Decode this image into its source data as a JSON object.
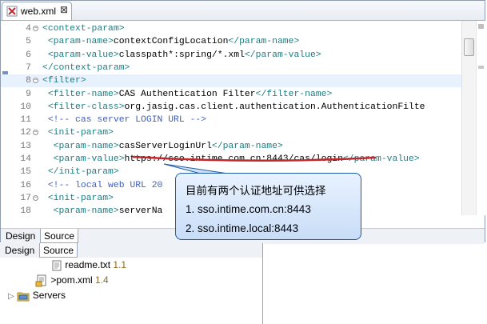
{
  "editor": {
    "tab_label": "web.xml",
    "tab_close": "⊠",
    "lines": [
      {
        "n": "4",
        "fold": true,
        "parts": [
          [
            "t",
            "<context-param>"
          ]
        ]
      },
      {
        "n": "5",
        "parts": [
          [
            "v",
            " "
          ],
          [
            "t",
            "<param-name>"
          ],
          [
            "v",
            "contextConfigLocation"
          ],
          [
            "t",
            "</param-name>"
          ]
        ]
      },
      {
        "n": "6",
        "parts": [
          [
            "v",
            " "
          ],
          [
            "t",
            "<param-value>"
          ],
          [
            "v",
            "classpath*:spring/*.xml"
          ],
          [
            "t",
            "</param-value>"
          ]
        ]
      },
      {
        "n": "7",
        "parts": [
          [
            "t",
            "</context-param>"
          ]
        ]
      },
      {
        "n": "8",
        "fold": true,
        "current": true,
        "parts": [
          [
            "t",
            "<filter>"
          ]
        ]
      },
      {
        "n": "9",
        "parts": [
          [
            "v",
            " "
          ],
          [
            "t",
            "<filter-name>"
          ],
          [
            "v",
            "CAS Authentication Filter"
          ],
          [
            "t",
            "</filter-name>"
          ]
        ]
      },
      {
        "n": "10",
        "parts": [
          [
            "v",
            " "
          ],
          [
            "t",
            "<filter-class>"
          ],
          [
            "v",
            "org.jasig.cas.client.authentication.AuthenticationFilte"
          ]
        ]
      },
      {
        "n": "11",
        "parts": [
          [
            "v",
            " "
          ],
          [
            "c",
            "<!-- cas server LOGIN URL -->"
          ]
        ]
      },
      {
        "n": "12",
        "fold": true,
        "parts": [
          [
            "v",
            " "
          ],
          [
            "t",
            "<init-param>"
          ]
        ]
      },
      {
        "n": "13",
        "parts": [
          [
            "v",
            "  "
          ],
          [
            "t",
            "<param-name>"
          ],
          [
            "v",
            "casServerLoginUrl"
          ],
          [
            "t",
            "</param-name>"
          ]
        ]
      },
      {
        "n": "14",
        "parts": [
          [
            "v",
            "  "
          ],
          [
            "t",
            "<param-value>"
          ],
          [
            "v",
            "https://sso.intime.com.cn:8443/cas/login"
          ],
          [
            "t",
            "</param-value>"
          ]
        ]
      },
      {
        "n": "15",
        "parts": [
          [
            "v",
            " "
          ],
          [
            "t",
            "</init-param>"
          ]
        ]
      },
      {
        "n": "16",
        "parts": [
          [
            "v",
            " "
          ],
          [
            "c",
            "<!-- local web URL 20"
          ]
        ]
      },
      {
        "n": "17",
        "fold": true,
        "parts": [
          [
            "v",
            " "
          ],
          [
            "t",
            "<init-param>"
          ]
        ]
      },
      {
        "n": "18",
        "parts": [
          [
            "v",
            "  "
          ],
          [
            "t",
            "<param-name>"
          ],
          [
            "v",
            "serverNa"
          ]
        ]
      }
    ],
    "bottom_tabs": [
      "Design",
      "Source"
    ]
  },
  "echo_tabs": [
    "Design",
    "Source"
  ],
  "tree": {
    "items": [
      {
        "label": "readme.txt",
        "decoration": "1.1"
      },
      {
        "label": "pom.xml",
        "prefix": ">",
        "decoration": "1.4"
      },
      {
        "label": "Servers"
      }
    ]
  },
  "callout": {
    "title": "目前有两个认证地址可供选择",
    "line1": "1. sso.intime.com.cn:8443",
    "line2": "2. sso.intime.local:8443"
  },
  "colors": {
    "tag": "#1e7c82",
    "comment": "#3f5fbf",
    "callout_border": "#1d5aa8",
    "underline": "#c0282d"
  }
}
